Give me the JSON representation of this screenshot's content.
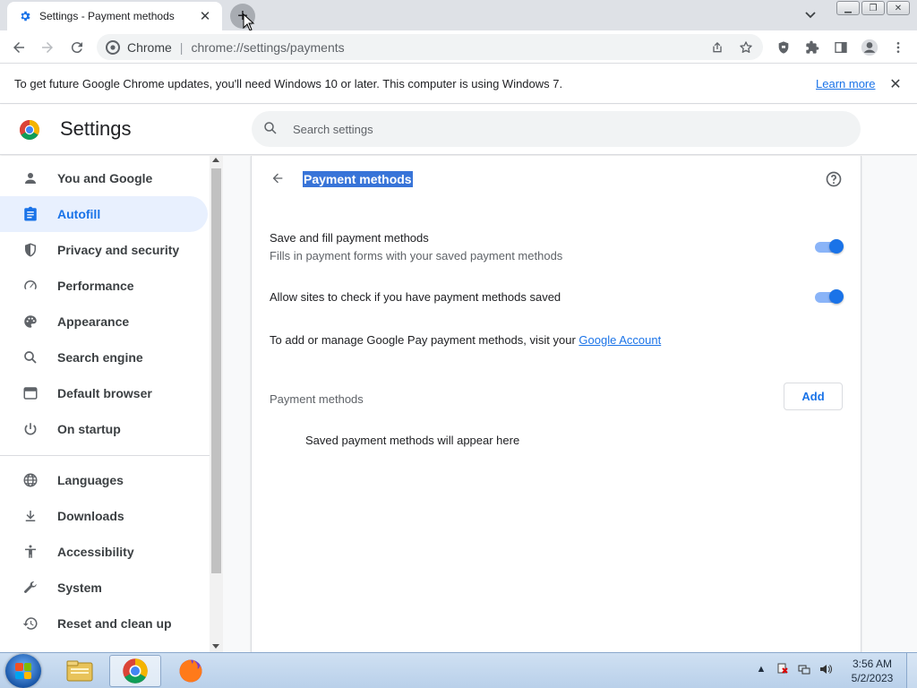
{
  "browser": {
    "tab_title": "Settings - Payment methods",
    "omnibox_chip": "Chrome",
    "omnibox_url": "chrome://settings/payments"
  },
  "infobar": {
    "message": "To get future Google Chrome updates, you'll need Windows 10 or later. This computer is using Windows 7.",
    "link": "Learn more"
  },
  "settings": {
    "title": "Settings",
    "search_placeholder": "Search settings"
  },
  "sidebar": {
    "items": [
      {
        "label": "You and Google",
        "icon": "person-icon"
      },
      {
        "label": "Autofill",
        "icon": "clipboard-icon",
        "active": true
      },
      {
        "label": "Privacy and security",
        "icon": "shield-icon"
      },
      {
        "label": "Performance",
        "icon": "speedometer-icon"
      },
      {
        "label": "Appearance",
        "icon": "palette-icon"
      },
      {
        "label": "Search engine",
        "icon": "search-icon"
      },
      {
        "label": "Default browser",
        "icon": "browser-window-icon"
      },
      {
        "label": "On startup",
        "icon": "power-icon"
      },
      {
        "label": "Languages",
        "icon": "globe-icon"
      },
      {
        "label": "Downloads",
        "icon": "download-icon"
      },
      {
        "label": "Accessibility",
        "icon": "accessibility-icon"
      },
      {
        "label": "System",
        "icon": "wrench-icon"
      },
      {
        "label": "Reset and clean up",
        "icon": "history-icon"
      }
    ]
  },
  "payments": {
    "page_title": "Payment methods",
    "save_fill_label": "Save and fill payment methods",
    "save_fill_sub": "Fills in payment forms with your saved payment methods",
    "save_fill_enabled": true,
    "allow_check_label": "Allow sites to check if you have payment methods saved",
    "allow_check_enabled": true,
    "gpay_text": "To add or manage Google Pay payment methods, visit your ",
    "gpay_link": "Google Account",
    "section_label": "Payment methods",
    "add_label": "Add",
    "empty_text": "Saved payment methods will appear here"
  },
  "taskbar": {
    "time": "3:56 AM",
    "date": "5/2/2023"
  },
  "colors": {
    "accent": "#1a73e8",
    "active_nav_bg": "#e8f0fe",
    "selection_bg": "#3874d8",
    "toggle_track": "#8ab4f8"
  }
}
